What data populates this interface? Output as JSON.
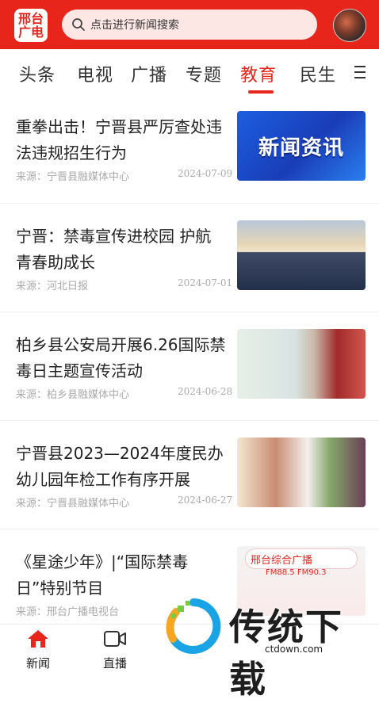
{
  "header": {
    "logo_line1": "邢台",
    "logo_line2": "广电",
    "search_placeholder": "点击进行新闻搜索"
  },
  "tabs": [
    {
      "label": "头条"
    },
    {
      "label": "电视"
    },
    {
      "label": "广播"
    },
    {
      "label": "专题"
    },
    {
      "label": "教育",
      "active": true
    },
    {
      "label": "民生"
    }
  ],
  "news": [
    {
      "title": "重拳出击！宁晋县严厉查处违法违规招生行为",
      "source": "来源：宁晋县融媒体中心",
      "date": "2024-07-09",
      "thumb_text": "新闻资讯"
    },
    {
      "title": "宁晋：禁毒宣传进校园 护航青春助成长",
      "source": "来源：河北日报",
      "date": "2024-07-01"
    },
    {
      "title": "柏乡县公安局开展6.26国际禁毒日主题宣传活动",
      "source": "来源：柏乡县融媒体中心",
      "date": "2024-06-28"
    },
    {
      "title": "宁晋县2023—2024年度民办幼儿园年检工作有序开展",
      "source": "来源：宁晋县融媒体中心",
      "date": "2024-06-27"
    },
    {
      "title": "《星途少年》|“国际禁毒日”特别节目",
      "source": "来源：邢台广播电视台",
      "date": "",
      "thumb_text": "邢台综合广播",
      "thumb_freq": "FM88.5     FM90.3"
    }
  ],
  "tabbar": [
    {
      "label": "新闻",
      "icon": "home-icon",
      "active": true
    },
    {
      "label": "直播",
      "icon": "video-camera-icon"
    }
  ],
  "watermark": {
    "title": "传统下载",
    "url": "ctdown.com"
  },
  "colors": {
    "brand": "#e8251b",
    "text": "#222222",
    "meta": "#aaaaaa"
  }
}
